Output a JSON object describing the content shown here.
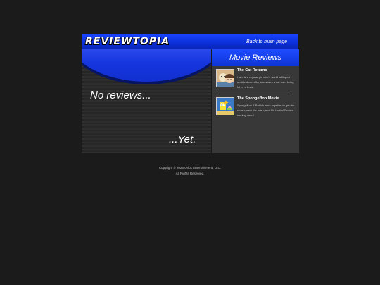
{
  "header": {
    "logo_text": "REVIEWTOPIA",
    "back_link": "Back to main page"
  },
  "main": {
    "headline": "No reviews...",
    "subline": "...Yet."
  },
  "sidebar": {
    "title": "Movie Reviews",
    "reviews": [
      {
        "title": "The Cat Returns",
        "description": "Haru is a regular girl who's world is flipped upside down after she saves a cat from being hit by a truck.",
        "thumbnail": "cat-returns-poster"
      },
      {
        "title": "The SpongeBob Movie",
        "description": "SpongeBob & Patrick work together to get the crown, save the town, and Mr. Krabs! Review coming soon!",
        "thumbnail": "spongebob-movie-poster"
      }
    ]
  },
  "footer": {
    "copyright": "Copyright © 2025 Orlok Entertainment, LLC.",
    "rights": "All Rights Reserved."
  },
  "colors": {
    "accent_blue": "#1a45ff",
    "page_bg": "#1b1b1b",
    "panel_bg": "#2a2a2a"
  }
}
